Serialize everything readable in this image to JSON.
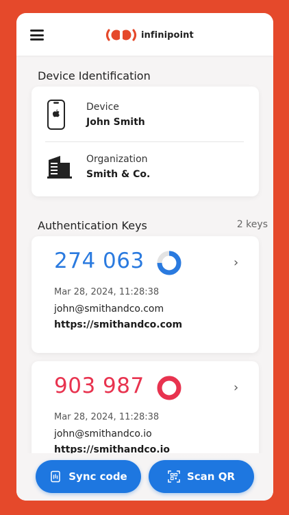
{
  "brand": {
    "name": "infinipoint",
    "color": "#E5492B"
  },
  "device_section": {
    "title": "Device Identification",
    "device_label": "Device",
    "device_value": "John Smith",
    "org_label": "Organization",
    "org_value": "Smith & Co."
  },
  "keys_section": {
    "title": "Authentication Keys",
    "count": "2 keys",
    "keys": [
      {
        "code": "274 063",
        "code_color": "#2A7ADF",
        "timer_fraction": 0.75,
        "date": "Mar 28, 2024, 11:28:38",
        "email": "john@smithandco.com",
        "url": "https://smithandco.com"
      },
      {
        "code": "903 987",
        "code_color": "#E8334F",
        "timer_fraction": 1.0,
        "date": "Mar 28, 2024, 11:28:38",
        "email": "john@smithandco.io",
        "url": "https://smithandco.io"
      }
    ]
  },
  "actions": {
    "sync_label": "Sync code",
    "scan_label": "Scan QR",
    "button_color": "#1E77E0"
  },
  "icons": [
    "menu-icon",
    "iphone-icon",
    "apple-icon",
    "building-icon",
    "timer-icon",
    "chevron-right-icon",
    "sync-icon",
    "qr-scan-icon"
  ]
}
